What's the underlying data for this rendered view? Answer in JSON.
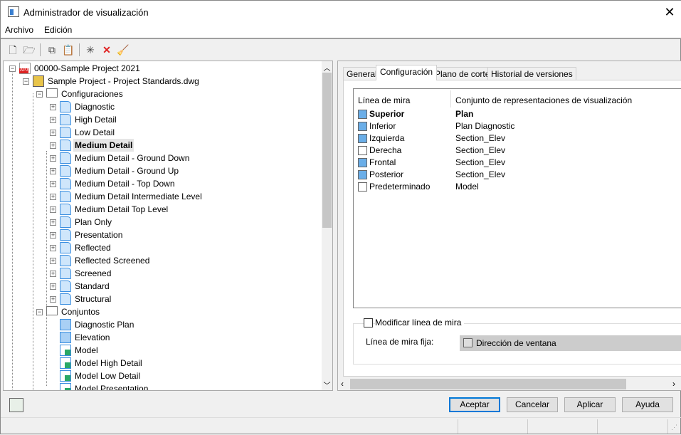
{
  "window": {
    "title": "Administrador de visualización",
    "close_icon": "close-icon"
  },
  "menu": [
    {
      "label": "Archivo"
    },
    {
      "label": "Edición"
    }
  ],
  "toolbar": [
    "new-icon",
    "open-icon",
    "copy-icon",
    "paste-icon",
    "new-item-icon",
    "delete-icon",
    "purge-icon"
  ],
  "tree": {
    "items": [
      {
        "label": "00000-Sample Project 2021",
        "level": 0,
        "icon": "apj",
        "toggle": "-"
      },
      {
        "label": "Sample Project - Project Standards.dwg",
        "level": 1,
        "icon": "dwg",
        "toggle": "-"
      },
      {
        "label": "Configuraciones",
        "level": 2,
        "icon": "folder",
        "toggle": "-"
      },
      {
        "label": "Diagnostic",
        "level": 3,
        "icon": "cfg",
        "toggle": "+"
      },
      {
        "label": "High Detail",
        "level": 3,
        "icon": "cfg",
        "toggle": "+"
      },
      {
        "label": "Low Detail",
        "level": 3,
        "icon": "cfg",
        "toggle": "+"
      },
      {
        "label": "Medium Detail",
        "level": 3,
        "icon": "cfg",
        "toggle": "+",
        "selected": true
      },
      {
        "label": "Medium Detail - Ground Down",
        "level": 3,
        "icon": "cfg",
        "toggle": "+"
      },
      {
        "label": "Medium Detail - Ground Up",
        "level": 3,
        "icon": "cfg",
        "toggle": "+"
      },
      {
        "label": "Medium Detail - Top Down",
        "level": 3,
        "icon": "cfg",
        "toggle": "+"
      },
      {
        "label": "Medium Detail Intermediate Level",
        "level": 3,
        "icon": "cfg",
        "toggle": "+"
      },
      {
        "label": "Medium Detail Top Level",
        "level": 3,
        "icon": "cfg",
        "toggle": "+"
      },
      {
        "label": "Plan Only",
        "level": 3,
        "icon": "cfg",
        "toggle": "+"
      },
      {
        "label": "Presentation",
        "level": 3,
        "icon": "cfg",
        "toggle": "+"
      },
      {
        "label": "Reflected",
        "level": 3,
        "icon": "cfg",
        "toggle": "+"
      },
      {
        "label": "Reflected Screened",
        "level": 3,
        "icon": "cfg",
        "toggle": "+"
      },
      {
        "label": "Screened",
        "level": 3,
        "icon": "cfg",
        "toggle": "+"
      },
      {
        "label": "Standard",
        "level": 3,
        "icon": "cfg",
        "toggle": "+"
      },
      {
        "label": "Structural",
        "level": 3,
        "icon": "cfg",
        "toggle": "+"
      },
      {
        "label": "Conjuntos",
        "level": 2,
        "icon": "folder",
        "toggle": "-"
      },
      {
        "label": "Diagnostic Plan",
        "level": 3,
        "icon": "set"
      },
      {
        "label": "Elevation",
        "level": 3,
        "icon": "set"
      },
      {
        "label": "Model",
        "level": 3,
        "icon": "model"
      },
      {
        "label": "Model High Detail",
        "level": 3,
        "icon": "model"
      },
      {
        "label": "Model Low Detail",
        "level": 3,
        "icon": "model"
      },
      {
        "label": "Model Presentation",
        "level": 3,
        "icon": "model"
      }
    ]
  },
  "tabs": [
    {
      "label": "General"
    },
    {
      "label": "Configuración",
      "active": true
    },
    {
      "label": "Plano de corte"
    },
    {
      "label": "Historial de versiones"
    }
  ],
  "view_table": {
    "headers": [
      "Línea de mira",
      "Conjunto de representaciones de visualización"
    ],
    "rows": [
      {
        "view": "Superior",
        "set": "Plan",
        "bold": true,
        "icon": "cube-top-icon"
      },
      {
        "view": "Inferior",
        "set": "Plan Diagnostic",
        "icon": "cube-bottom-icon"
      },
      {
        "view": "Izquierda",
        "set": "Section_Elev",
        "icon": "cube-left-icon"
      },
      {
        "view": "Derecha",
        "set": "Section_Elev",
        "icon": "cube-right-icon"
      },
      {
        "view": "Frontal",
        "set": "Section_Elev",
        "icon": "cube-front-icon"
      },
      {
        "view": "Posterior",
        "set": "Section_Elev",
        "icon": "cube-back-icon"
      },
      {
        "view": "Predeterminado",
        "set": "Model",
        "icon": "cube-default-icon"
      }
    ]
  },
  "override": {
    "checkbox_label": "Modificar línea de mira",
    "checked": false,
    "fixed_label": "Línea de mira fija:",
    "fixed_value": "Dirección de ventana"
  },
  "buttons": {
    "ok": "Aceptar",
    "cancel": "Cancelar",
    "apply": "Aplicar",
    "help": "Ayuda"
  },
  "colors": {
    "accent": "#0078d7",
    "cube_face": "#6aaee8"
  }
}
